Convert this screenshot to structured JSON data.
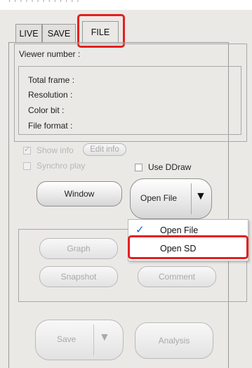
{
  "tabs": [
    {
      "label": "LIVE"
    },
    {
      "label": "SAVE"
    },
    {
      "label": "FILE"
    }
  ],
  "viewer_number_label": "Viewer number :",
  "info": {
    "total_frame": "Total frame :",
    "resolution": "Resolution :",
    "color_bit": "Color bit :",
    "file_format": "File format :"
  },
  "options": {
    "show_info": "Show info",
    "edit_info": "Edit info",
    "synchro_play": "Synchro play",
    "use_ddraw": "Use DDraw"
  },
  "buttons": {
    "window": "Window",
    "open_file": "Open File",
    "graph": "Graph",
    "snapshot": "Snapshot",
    "comment": "Comment",
    "save": "Save",
    "analysis": "Analysis"
  },
  "open_menu": {
    "items": [
      {
        "label": "Open File",
        "checked": true
      },
      {
        "label": "Open SD",
        "checked": false
      }
    ]
  },
  "highlight_color": "#e32020"
}
